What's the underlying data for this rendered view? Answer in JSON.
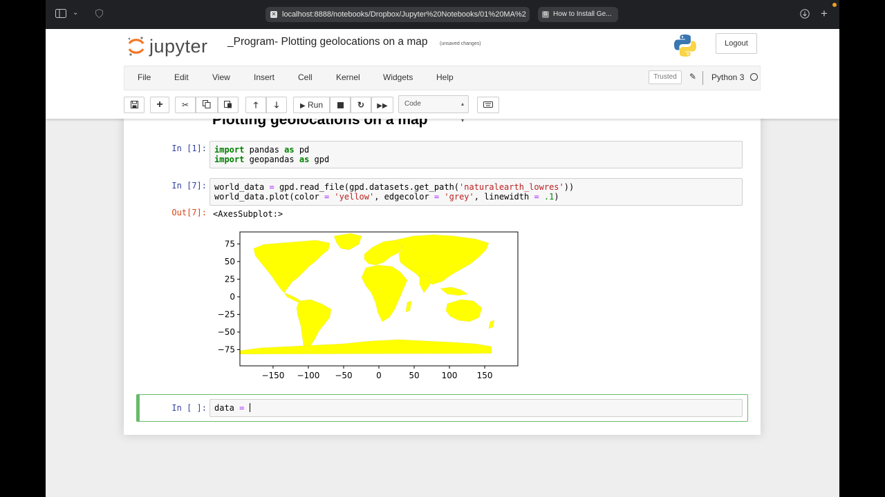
{
  "browser": {
    "url": "localhost:8888/notebooks/Dropbox/Jupyter%20Notebooks/01%20MA%2",
    "other_tab": "How to Install Ge...",
    "other_tab_icon": "G"
  },
  "header": {
    "logo_text": "jupyter",
    "notebook_title": "_Program- Plotting geolocations on a map",
    "save_status": "(unsaved changes)",
    "logout_label": "Logout"
  },
  "menu": {
    "items": [
      "File",
      "Edit",
      "View",
      "Insert",
      "Cell",
      "Kernel",
      "Widgets",
      "Help"
    ],
    "trusted_label": "Trusted",
    "kernel_name": "Python 3"
  },
  "toolbar": {
    "run_label": "Run",
    "cell_type": "Code"
  },
  "notebook": {
    "heading": "Plotting geolocations on a map",
    "cells": [
      {
        "prompt": "In [1]:",
        "lines": [
          "import pandas as pd",
          "import geopandas as gpd"
        ]
      },
      {
        "prompt": "In [7]:",
        "lines": [
          "world_data = gpd.read_file(gpd.datasets.get_path('naturalearth_lowres'))",
          "world_data.plot(color = 'yellow', edgecolor = 'grey', linewidth = .1)"
        ]
      },
      {
        "prompt": "In [ ]:",
        "lines": [
          "data = "
        ]
      }
    ],
    "output_prompt": "Out[7]:",
    "output_text": "<AxesSubplot:>"
  },
  "chart_data": {
    "type": "map",
    "fill_color": "#ffff00",
    "edge_color": "grey",
    "x_ticks": [
      "−150",
      "−100",
      "−50",
      "0",
      "50",
      "100",
      "150"
    ],
    "y_ticks": [
      "75",
      "50",
      "25",
      "0",
      "−25",
      "−50",
      "−75"
    ],
    "xlim": [
      -197,
      197
    ],
    "ylim": [
      -98,
      92
    ]
  }
}
